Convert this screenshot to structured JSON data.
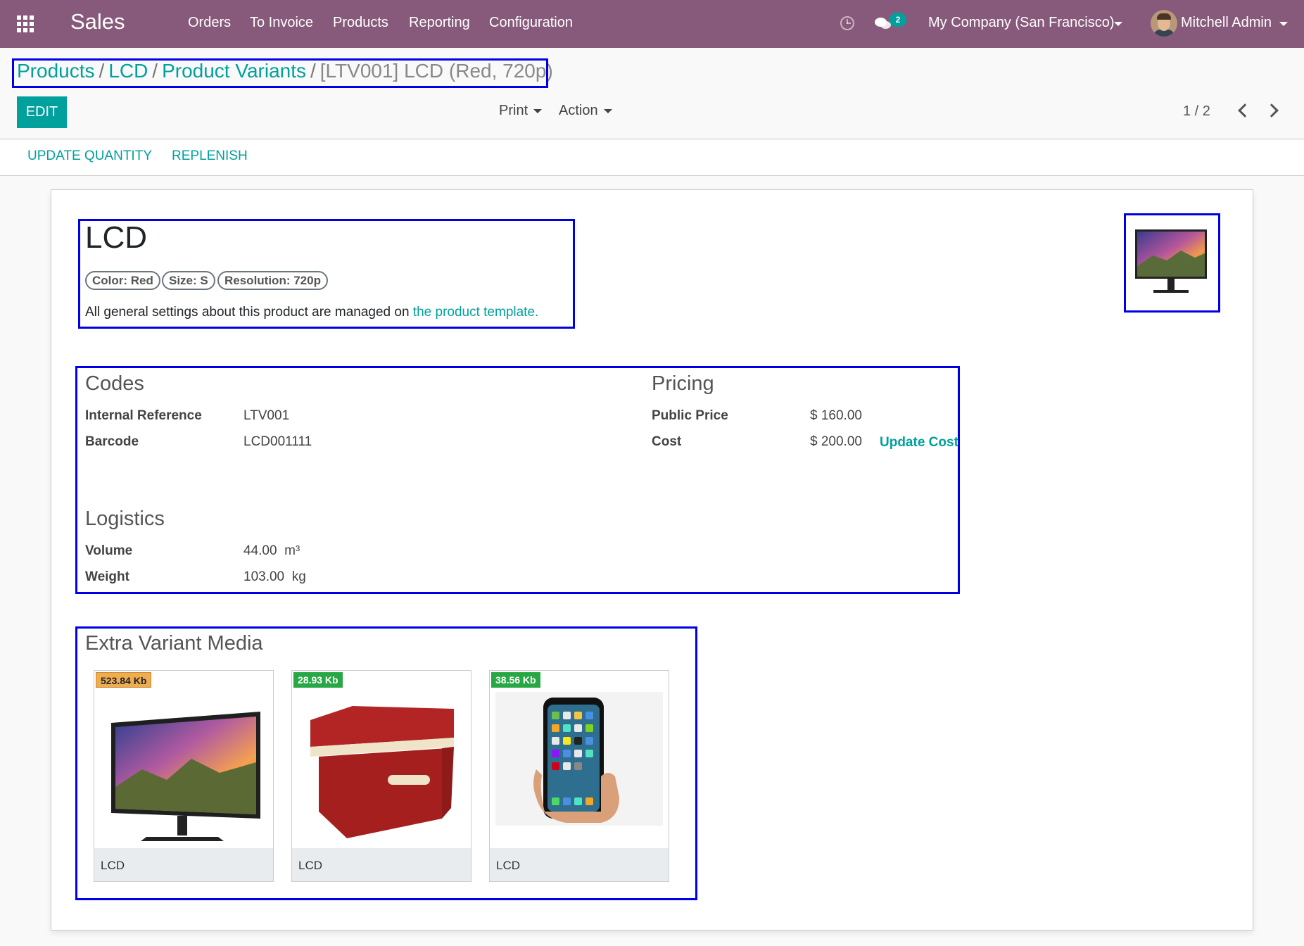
{
  "navbar": {
    "app_name": "Sales",
    "menu": [
      "Orders",
      "To Invoice",
      "Products",
      "Reporting",
      "Configuration"
    ],
    "chat_count": "2",
    "company": "My Company (San Francisco)",
    "user": "Mitchell Admin",
    "color": "#875a7b"
  },
  "breadcrumb": {
    "items": [
      "Products",
      "LCD",
      "Product Variants"
    ],
    "current": "[LTV001] LCD (Red, 720p)"
  },
  "control_panel": {
    "edit_label": "EDIT",
    "print_label": "Print",
    "action_label": "Action",
    "pager": "1 / 2"
  },
  "statusbar": {
    "update_quantity": "UPDATE QUANTITY",
    "replenish": "REPLENISH"
  },
  "product": {
    "name": "LCD",
    "tags": [
      "Color: Red",
      "Size: S",
      "Resolution: 720p"
    ],
    "note_text": "All general settings about this product are managed on",
    "note_link": "the product template.",
    "image": "monitor"
  },
  "codes": {
    "title": "Codes",
    "internal_reference_label": "Internal Reference",
    "internal_reference": "LTV001",
    "barcode_label": "Barcode",
    "barcode": "LCD001111"
  },
  "pricing": {
    "title": "Pricing",
    "public_price_label": "Public Price",
    "public_price": "$ 160.00",
    "cost_label": "Cost",
    "cost": "$ 200.00",
    "update_cost": "Update Cost"
  },
  "logistics": {
    "title": "Logistics",
    "volume_label": "Volume",
    "volume": "44.00",
    "volume_unit": "m³",
    "weight_label": "Weight",
    "weight": "103.00",
    "weight_unit": "kg"
  },
  "media": {
    "title": "Extra Variant Media",
    "items": [
      {
        "size": "523.84 Kb",
        "caption": "LCD",
        "image": "monitor"
      },
      {
        "size": "28.93 Kb",
        "caption": "LCD",
        "image": "red-storage-box"
      },
      {
        "size": "38.56 Kb",
        "caption": "LCD",
        "image": "smartphone-in-hand"
      }
    ]
  }
}
